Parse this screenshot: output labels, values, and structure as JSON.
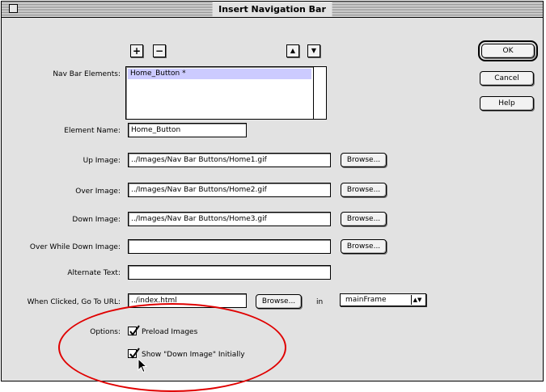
{
  "window": {
    "title": "Insert Navigation Bar"
  },
  "nav_elements": {
    "label": "Nav Bar Elements:",
    "add": "+",
    "remove": "−",
    "move_up": "▲",
    "move_down": "▼",
    "items": [
      "Home_Button *"
    ]
  },
  "element_name": {
    "label": "Element Name:",
    "value": "Home_Button"
  },
  "up_image": {
    "label": "Up Image:",
    "value": "../Images/Nav Bar Buttons/Home1.gif",
    "browse": "Browse..."
  },
  "over_image": {
    "label": "Over Image:",
    "value": "../Images/Nav Bar Buttons/Home2.gif",
    "browse": "Browse..."
  },
  "down_image": {
    "label": "Down Image:",
    "value": "../Images/Nav Bar Buttons/Home3.gif",
    "browse": "Browse..."
  },
  "over_while_down": {
    "label": "Over While Down Image:",
    "value": "",
    "browse": "Browse..."
  },
  "alt_text": {
    "label": "Alternate Text:",
    "value": ""
  },
  "url": {
    "label": "When Clicked, Go To URL:",
    "value": "../index.html",
    "browse": "Browse...",
    "in_label": "in",
    "target": "mainFrame"
  },
  "options": {
    "label": "Options:",
    "preload": {
      "label": "Preload Images",
      "checked": true
    },
    "show_down": {
      "label": "Show \"Down Image\" Initially",
      "checked": true
    }
  },
  "buttons": {
    "ok": "OK",
    "cancel": "Cancel",
    "help": "Help"
  },
  "annotation_color": "#e00000"
}
